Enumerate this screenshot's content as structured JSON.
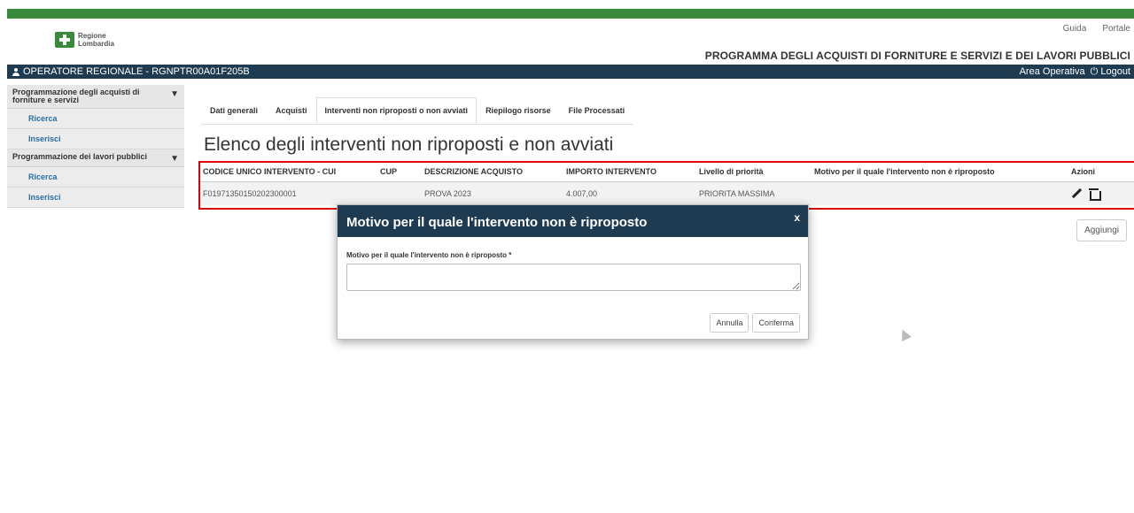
{
  "header": {
    "logo_line1": "Regione",
    "logo_line2": "Lombardia",
    "links": [
      "Guida",
      "Portale"
    ],
    "program_title": "PROGRAMMA DEGLI ACQUISTI DI FORNITURE E SERVIZI E DEI LAVORI PUBBLICI"
  },
  "userbar": {
    "user": "OPERATORE REGIONALE - RGNPTR00A01F205B",
    "area": "Area Operativa",
    "logout": "Logout"
  },
  "sidebar": {
    "groups": [
      {
        "label": "Programmazione degli acquisti di forniture e servizi",
        "items": [
          "Ricerca",
          "Inserisci"
        ]
      },
      {
        "label": "Programmazione dei lavori pubblici",
        "items": [
          "Ricerca",
          "Inserisci"
        ]
      }
    ]
  },
  "tabs": [
    "Dati generali",
    "Acquisti",
    "Interventi non riproposti o non avviati",
    "Riepilogo risorse",
    "File Processati"
  ],
  "active_tab": 2,
  "page_title": "Elenco degli interventi non riproposti e non avviati",
  "table": {
    "headers": [
      "CODICE UNICO INTERVENTO - CUI",
      "CUP",
      "DESCRIZIONE ACQUISTO",
      "IMPORTO INTERVENTO",
      "Livello di priorità",
      "Motivo per il quale l'intervento non è riproposto",
      "Azioni"
    ],
    "rows": [
      [
        "F01971350150202300001",
        "",
        "PROVA 2023",
        "4.007,00",
        "PRIORITA MASSIMA",
        ""
      ]
    ]
  },
  "add_button": "Aggiungi",
  "modal": {
    "title": "Motivo per il quale l'intervento non è riproposto",
    "close": "x",
    "field_label": "Motivo per il quale l'intervento non è riproposto *",
    "field_value": "",
    "cancel": "Annulla",
    "confirm": "Conferma"
  },
  "colors": {
    "brand_green": "#3a8a3c",
    "navy": "#1e3b52",
    "highlight": "#dd0000"
  }
}
